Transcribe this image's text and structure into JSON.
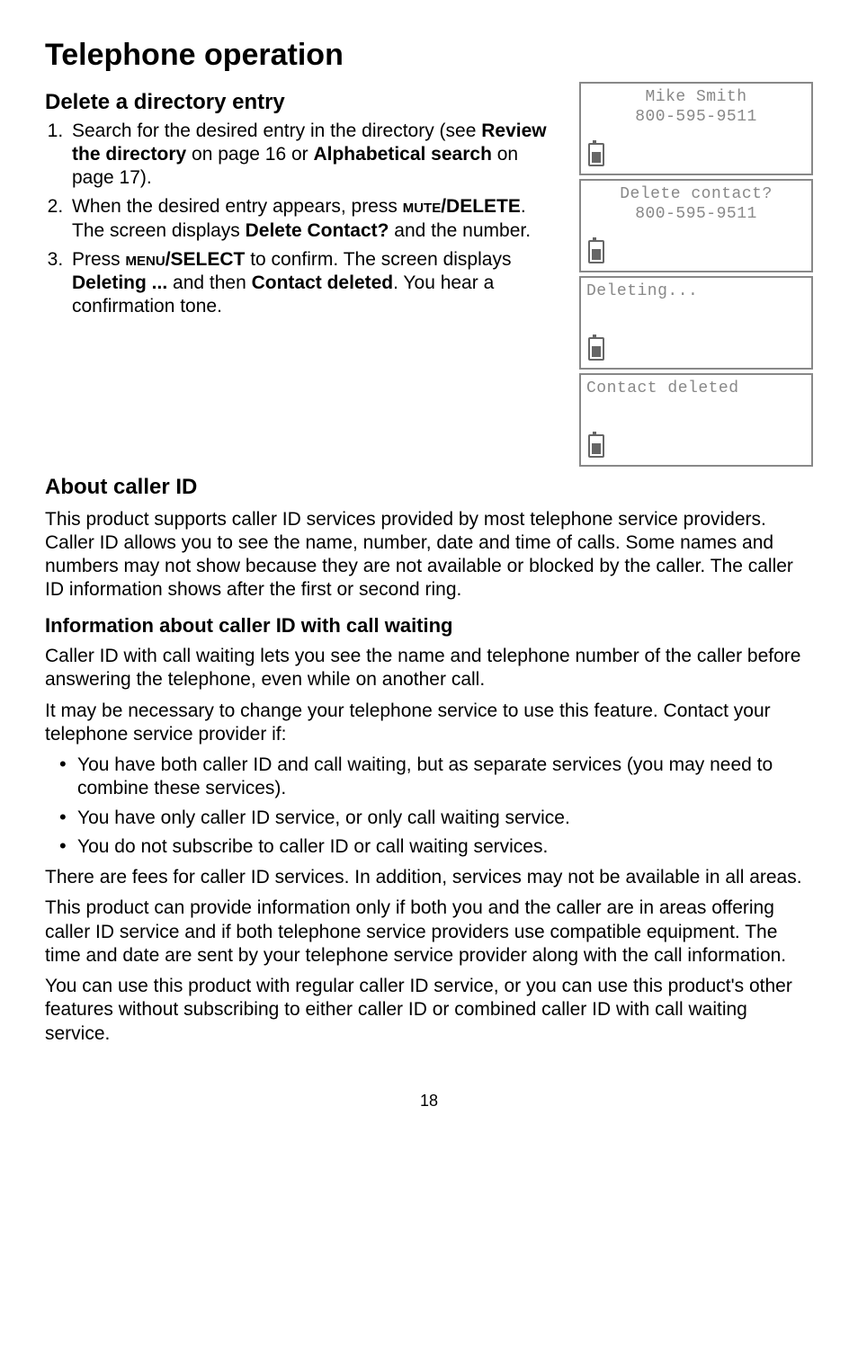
{
  "title": "Telephone operation",
  "delete_section": {
    "heading": "Delete a directory entry",
    "step1_a": "Search for the desired entry in the directory (see ",
    "step1_b": "Review the directory",
    "step1_c": " on page 16 or ",
    "step1_d": "Alphabetical search",
    "step1_e": " on page 17).",
    "step2_a": "When the desired entry appears, press ",
    "step2_key": "mute",
    "step2_b": "/DELETE",
    "step2_c": ". The screen displays ",
    "step2_d": "Delete Contact?",
    "step2_e": " and the number.",
    "step3_a": "Press ",
    "step3_key": "menu",
    "step3_b": "/SELECT",
    "step3_c": " to confirm. The screen displays ",
    "step3_d": "Deleting ...",
    "step3_e": " and then ",
    "step3_f": "Contact deleted",
    "step3_g": ". You hear a confirmation tone."
  },
  "screens": {
    "s1_l1": "Mike Smith",
    "s1_l2": "800-595-9511",
    "s2_l1": "Delete contact?",
    "s2_l2": "800-595-9511",
    "s3_l1": "Deleting...",
    "s4_l1": "Contact deleted"
  },
  "callerid": {
    "heading": "About caller ID",
    "p1": "This product supports caller ID services provided by most telephone service providers. Caller ID allows you to see the name, number, date and time of calls. Some names and numbers may not show because they are not available or blocked by the caller. The caller ID information shows after the first or second ring.",
    "subheading": "Information about caller ID with call waiting",
    "p2": "Caller ID with call waiting lets you see the name and telephone number of the caller before answering the telephone, even while on another call.",
    "p3": "It may be necessary to change your telephone service to use this feature. Contact your telephone service provider if:",
    "b1": "You have both caller ID and call waiting, but as separate services (you may need to combine these services).",
    "b2": "You have only caller ID service, or only call waiting service.",
    "b3": "You do not subscribe to caller ID or call waiting services.",
    "p4": "There are fees for caller ID services. In addition, services may not be available in all areas.",
    "p5": "This product can provide information only if both you and the caller are in areas offering caller ID service and if both telephone service providers use compatible equipment. The time and date are sent by your telephone service provider along with the call information.",
    "p6": "You can use this product with regular caller ID service, or you can use this product's other features without subscribing to either caller ID or combined caller ID with call waiting service."
  },
  "page": "18"
}
